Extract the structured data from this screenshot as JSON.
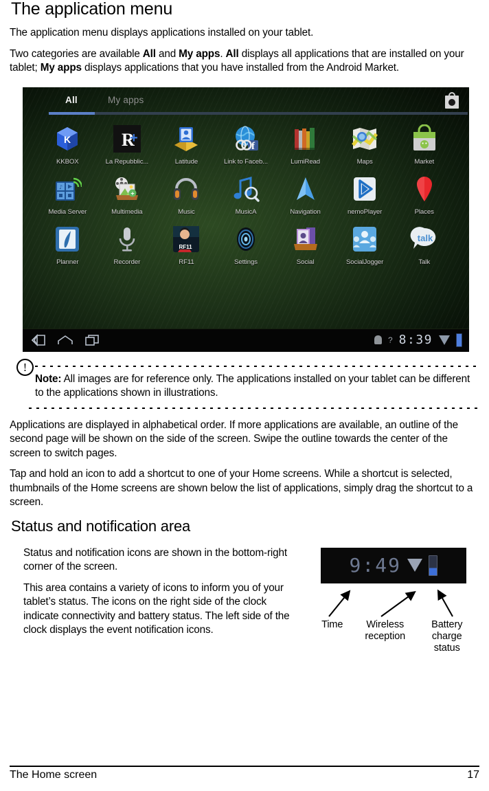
{
  "headings": {
    "application_menu": "The application menu",
    "status_area": "Status and notification area"
  },
  "paragraphs": {
    "p1": "The application menu displays applications installed on your tablet.",
    "p2_a": "Two categories are available ",
    "p2_b": "All",
    "p2_c": " and ",
    "p2_d": "My apps",
    "p2_e": ". ",
    "p2_f": "All",
    "p2_g": " displays all applications that are installed on your tablet; ",
    "p2_h": "My apps",
    "p2_i": " displays applications that you have installed from the Android Market.",
    "p3": "Applications are displayed in alphabetical order. If more applications are available, an outline of the second page will be shown on the side of the screen. Swipe the outline towards the center of the screen to switch pages.",
    "p4": "Tap and hold an icon to add a shortcut to one of your Home screens. While a shortcut is selected, thumbnails of the Home screens are shown below the list of applications, simply drag the shortcut to a screen.",
    "p5": "Status and notification icons are shown in the bottom-right corner of the screen.",
    "p6": "This area contains a variety of icons to inform you of your tablet’s status. The icons on the right side of the clock indicate connectivity and battery status. The left side of the clock displays the event notification icons."
  },
  "note": {
    "icon": "exclamation-circle-icon",
    "label": "Note:",
    "text": " All images are for reference only. The applications installed on your tablet can be different to the applications shown in illustrations."
  },
  "tablet_screenshot": {
    "tabs": [
      {
        "label": "All",
        "selected": true
      },
      {
        "label": "My apps",
        "selected": false
      }
    ],
    "shop_icon": "market-bag-icon",
    "apps": [
      {
        "label": "KKBOX",
        "icon": "kkbox-icon"
      },
      {
        "label": "La Repubblic...",
        "icon": "la-repubblica-icon"
      },
      {
        "label": "Latitude",
        "icon": "latitude-icon"
      },
      {
        "label": "Link to Faceb...",
        "icon": "link-to-facebook-icon"
      },
      {
        "label": "LumiRead",
        "icon": "lumiread-icon"
      },
      {
        "label": "Maps",
        "icon": "maps-icon"
      },
      {
        "label": "Market",
        "icon": "market-icon"
      },
      {
        "label": "Media Server",
        "icon": "media-server-icon"
      },
      {
        "label": "Multimedia",
        "icon": "multimedia-icon"
      },
      {
        "label": "Music",
        "icon": "music-icon"
      },
      {
        "label": "MusicA",
        "icon": "musica-icon"
      },
      {
        "label": "Navigation",
        "icon": "navigation-icon"
      },
      {
        "label": "nemoPlayer",
        "icon": "nemoplayer-icon"
      },
      {
        "label": "Places",
        "icon": "places-icon"
      },
      {
        "label": "Planner",
        "icon": "planner-icon"
      },
      {
        "label": "Recorder",
        "icon": "recorder-icon"
      },
      {
        "label": "RF11",
        "icon": "rf11-icon"
      },
      {
        "label": "Settings",
        "icon": "settings-icon"
      },
      {
        "label": "Social",
        "icon": "social-icon"
      },
      {
        "label": "SocialJogger",
        "icon": "socialjogger-icon"
      },
      {
        "label": "Talk",
        "icon": "talk-icon"
      }
    ],
    "system_bar": {
      "back_icon": "back-icon",
      "home_icon": "home-icon",
      "recents_icon": "recent-apps-icon",
      "android_icon": "android-robot-icon",
      "help_icon": "question-mark-icon",
      "clock": "8:39",
      "wifi_icon": "wireless-reception-icon",
      "battery_icon": "battery-icon"
    }
  },
  "status_figure": {
    "clock": "9:49",
    "wifi_icon": "wireless-reception-icon",
    "battery_icon": "battery-icon",
    "callouts": {
      "time": "Time",
      "wireless_line1": "Wireless",
      "wireless_line2": "reception",
      "battery_line1": "Battery",
      "battery_line2": "charge",
      "battery_line3": "status"
    }
  },
  "footer": {
    "chapter": "The Home screen",
    "page": "17"
  },
  "colors": {
    "tab_accent": "#5b7fc7",
    "clock_text": "#6d7890",
    "battery_fill": "#3d6fd8"
  }
}
